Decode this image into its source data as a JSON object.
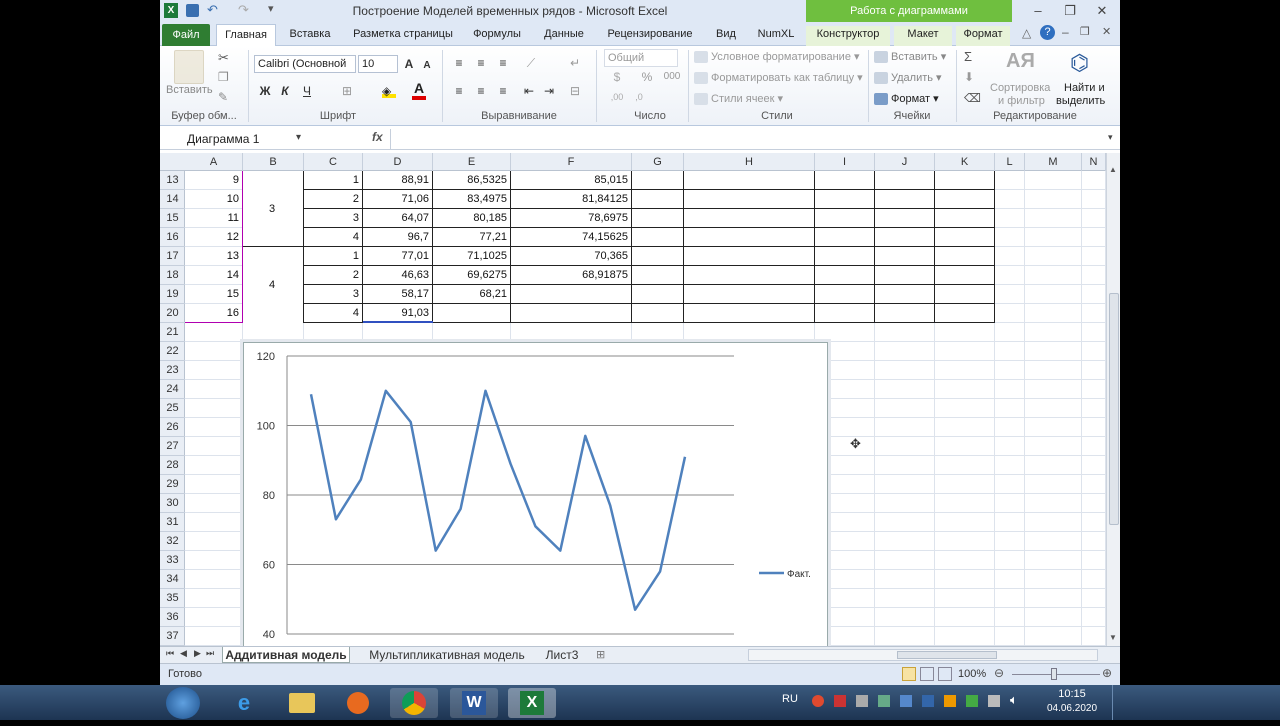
{
  "window": {
    "title": "Построение Моделей временных рядов - Microsoft Excel",
    "context_tab_group": "Работа с диаграммами"
  },
  "tabs": [
    {
      "label": "Файл"
    },
    {
      "label": "Главная"
    },
    {
      "label": "Вставка"
    },
    {
      "label": "Разметка страницы"
    },
    {
      "label": "Формулы"
    },
    {
      "label": "Данные"
    },
    {
      "label": "Рецензирование"
    },
    {
      "label": "Вид"
    },
    {
      "label": "NumXL"
    },
    {
      "label": "Конструктор"
    },
    {
      "label": "Макет"
    },
    {
      "label": "Формат"
    }
  ],
  "ribbon": {
    "clipboard": {
      "paste": "Вставить",
      "group": "Буфер обм..."
    },
    "font": {
      "name": "Calibri (Основной",
      "size": "10",
      "bold": "Ж",
      "italic": "К",
      "underline": "Ч",
      "group": "Шрифт"
    },
    "alignment": {
      "group": "Выравнивание"
    },
    "number": {
      "format": "Общий",
      "percent": "%",
      "thousands": "000",
      "group": "Число"
    },
    "styles": {
      "conditional": "Условное форматирование",
      "as_table": "Форматировать как таблицу",
      "cell_styles": "Стили ячеек",
      "group": "Стили"
    },
    "cells": {
      "insert": "Вставить",
      "delete": "Удалить",
      "format": "Формат",
      "group": "Ячейки"
    },
    "editing": {
      "sum": "Σ",
      "sort": "Сортировка",
      "sort2": "и фильтр",
      "find": "Найти и",
      "find2": "выделить",
      "group": "Редактирование"
    }
  },
  "formula_bar": {
    "name_box": "Диаграмма 1",
    "fx": "fx",
    "content": ""
  },
  "columns": [
    "A",
    "B",
    "C",
    "D",
    "E",
    "F",
    "G",
    "H",
    "I",
    "J",
    "K",
    "L",
    "M",
    "N"
  ],
  "rows": [
    "13",
    "14",
    "15",
    "16",
    "17",
    "18",
    "19",
    "20",
    "21",
    "22",
    "23",
    "24",
    "25",
    "26",
    "27",
    "28",
    "29",
    "30",
    "31",
    "32",
    "33",
    "34",
    "35",
    "36",
    "37"
  ],
  "table": [
    {
      "A": "9",
      "C": "1",
      "D": "88,91",
      "E": "86,5325",
      "F": "85,015"
    },
    {
      "A": "10",
      "C": "2",
      "D": "71,06",
      "E": "83,4975",
      "F": "81,84125"
    },
    {
      "A": "11",
      "C": "3",
      "D": "64,07",
      "E": "80,185",
      "F": "78,6975"
    },
    {
      "A": "12",
      "C": "4",
      "D": "96,7",
      "E": "77,21",
      "F": "74,15625"
    },
    {
      "A": "13",
      "C": "1",
      "D": "77,01",
      "E": "71,1025",
      "F": "70,365"
    },
    {
      "A": "14",
      "C": "2",
      "D": "46,63",
      "E": "69,6275",
      "F": "68,91875"
    },
    {
      "A": "15",
      "C": "3",
      "D": "58,17",
      "E": "68,21",
      "F": ""
    },
    {
      "A": "16",
      "C": "4",
      "D": "91,03",
      "E": "",
      "F": ""
    }
  ],
  "merged_b": [
    {
      "label": "3"
    },
    {
      "label": "4"
    }
  ],
  "chart_data": {
    "type": "line",
    "title": "",
    "xlabel": "",
    "ylabel": "",
    "ylim": [
      40,
      120
    ],
    "yticks": [
      "120",
      "100",
      "80",
      "60",
      "40"
    ],
    "legend": "right",
    "grid": true,
    "series": [
      {
        "name": "Факт.",
        "color": "#4f81bd",
        "values": [
          109,
          73,
          84.5,
          110,
          101,
          64,
          76,
          110,
          89,
          71,
          64,
          97,
          77,
          47,
          58,
          91
        ]
      }
    ]
  },
  "sheets": [
    "Аддитивная модель",
    "Мультипликативная модель",
    "Лист3"
  ],
  "status": {
    "ready": "Готово",
    "zoom": "100%"
  },
  "taskbar": {
    "lang": "RU",
    "time": "10:15",
    "date": "04.06.2020"
  }
}
